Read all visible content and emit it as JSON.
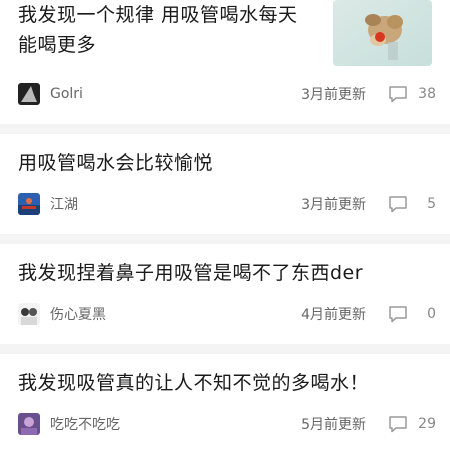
{
  "posts": [
    {
      "title_line1": "我发现一个规律 用吸管喝水每天",
      "title_line2": "能喝更多",
      "author": "Golri",
      "time": "3月前更新",
      "comments": "38"
    },
    {
      "title_line1": "用吸管喝水会比较愉悦",
      "author": "江湖",
      "time": "3月前更新",
      "comments": "5"
    },
    {
      "title_line1": "我发现捏着鼻子用吸管是喝不了东西der",
      "author": "伤心夏黑",
      "time": "4月前更新",
      "comments": "0"
    },
    {
      "title_line1": "我发现吸管真的让人不知不觉的多喝水！",
      "author": "吃吃不吃吃",
      "time": "5月前更新",
      "comments": "29"
    }
  ],
  "icons": {
    "comment": "comment-bubble-icon"
  },
  "colors": {
    "separator": "#f4f4f4",
    "meta_text": "#666666",
    "title_text": "#1a1a1a"
  }
}
